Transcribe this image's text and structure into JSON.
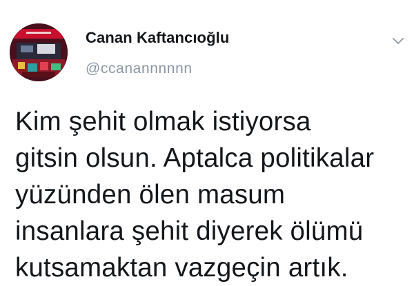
{
  "author": {
    "display_name": "Canan Kaftancıoğlu",
    "handle": "@ccanannnnnn",
    "avatar_icon": "profile-photo"
  },
  "menu": {
    "icon": "chevron-down-icon"
  },
  "tweet": {
    "lines": [
      "Kim şehit olmak istiyorsa",
      "gitsin olsun. Aptalca politikalar",
      "yüzünden ölen masum",
      "insanlara şehit diyerek ölümü",
      "kutsamaktan vazgeçin artık."
    ]
  },
  "colors": {
    "text": "#14171a",
    "secondary": "#8a97a3",
    "background": "#ffffff"
  }
}
